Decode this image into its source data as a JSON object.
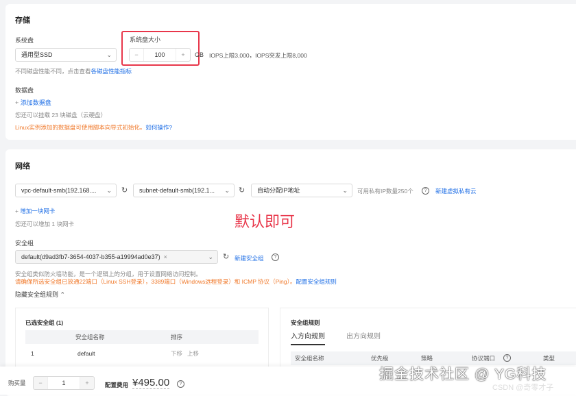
{
  "storage": {
    "title": "存储",
    "system_disk_label": "系统盘",
    "system_disk_type": "通用型SSD",
    "size_label": "系统盘大小",
    "size_value": "100",
    "unit": "GB",
    "iops": "IOPS上限3,000，IOPS突发上限8,000",
    "perf_note": "不同磁盘性能不同，点击查看",
    "perf_link": "各磁盘性能指标",
    "data_disk_label": "数据盘",
    "add_data_disk": "添加数据盘",
    "mount_note": "您还可以挂载 23 块磁盘（云硬盘）",
    "linux_note": "Linux实例添加的数据盘可使用脚本向导式初始化。",
    "how_link": "如何操作?"
  },
  "network": {
    "title": "网络",
    "vpc": "vpc-default-smb(192.168....",
    "subnet": "subnet-default-smb(192.1...",
    "ip": "自动分配IP地址",
    "ip_count": "可用私有IP数量250个",
    "new_vpc": "新建虚拟私有云",
    "add_nic": "增加一块网卡",
    "nic_note": "您还可以增加 1 块网卡",
    "annotation": "默认即可"
  },
  "security": {
    "label": "安全组",
    "value": "default(d9ad3fb7-3654-4037-b355-a19994ad0e37)",
    "new_link": "新建安全组",
    "desc": "安全组类似防火墙功能，是一个逻辑上的分组，用于设置网络访问控制。",
    "warn": "请确保所选安全组已放通22端口（Linux SSH登录），3389端口（Windows远程登录）和 ICMP 协议（Ping）。",
    "config_link": "配置安全组规则",
    "hide_rules": "隐藏安全组规则",
    "selected": {
      "title": "已选安全组 (1)",
      "headers": [
        "",
        "安全组名称",
        "排序"
      ],
      "rows": [
        {
          "idx": "1",
          "name": "default",
          "down": "下移",
          "up": "上移"
        }
      ]
    },
    "rules": {
      "title": "安全组规则",
      "tabs": [
        "入方向规则",
        "出方向规则"
      ],
      "headers": [
        "安全组名称",
        "优先级",
        "策略",
        "协议端口",
        "类型"
      ]
    }
  },
  "footer": {
    "qty_label": "购买量",
    "qty": "1",
    "fee_label": "配置费用",
    "fee": "¥495.00"
  },
  "watermark": {
    "main": "掘金技术社区 @ YG科技",
    "sub": "CSDN @奇零才子"
  },
  "colors": {
    "accent": "#1f6fe6",
    "highlight": "#e8364a",
    "warning": "#f07a2c"
  }
}
